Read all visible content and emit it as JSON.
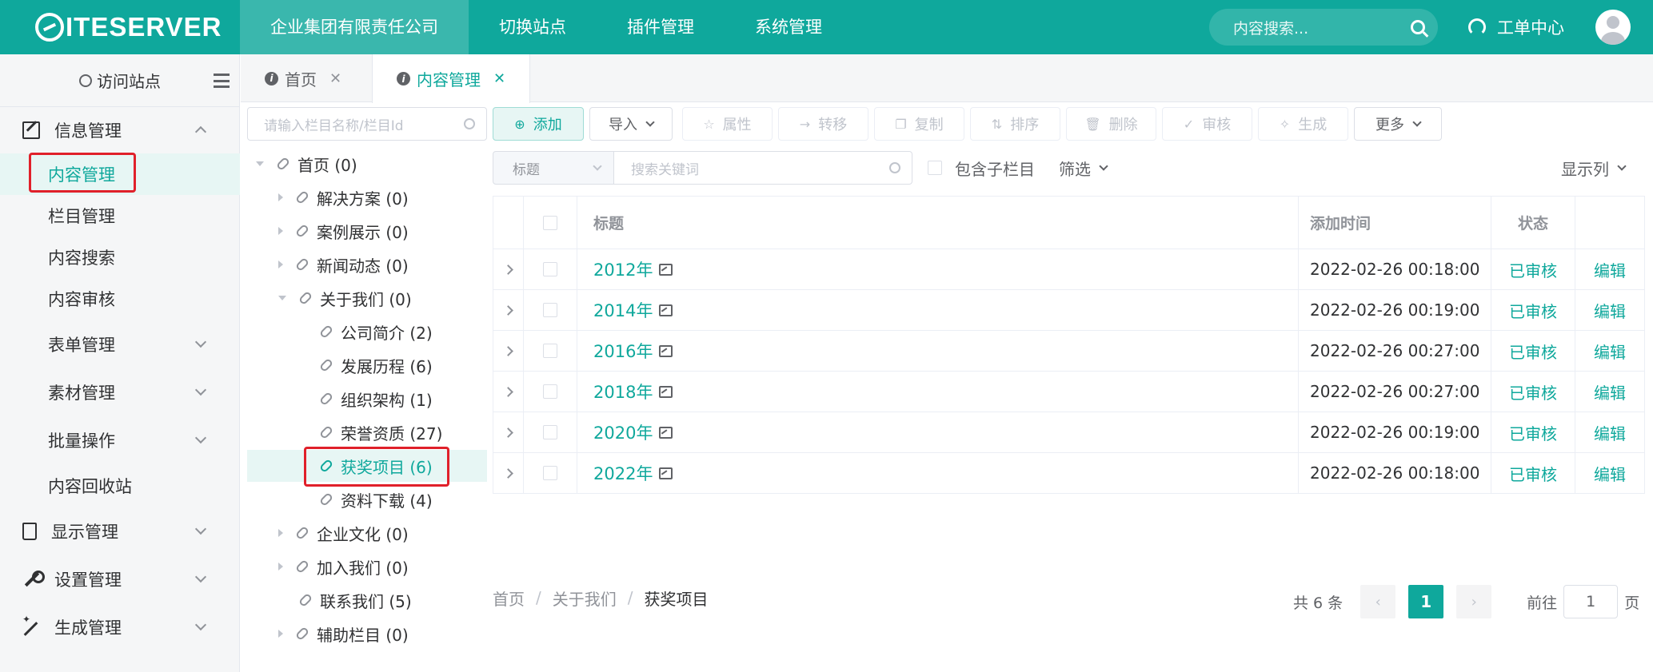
{
  "brand": {
    "logo_text": "ITESERVER"
  },
  "topnav": {
    "items": [
      "企业集团有限责任公司",
      "切换站点",
      "插件管理",
      "系统管理"
    ]
  },
  "top_search": {
    "placeholder": "内容搜索..."
  },
  "workorder": {
    "label": "工单中心"
  },
  "sidebar": {
    "visit_label": "访问站点",
    "groups": {
      "info": "信息管理",
      "display": "显示管理",
      "settings": "设置管理",
      "generate": "生成管理"
    },
    "items": {
      "content": "内容管理",
      "channel": "栏目管理",
      "search": "内容搜索",
      "review": "内容审核",
      "forms": "表单管理",
      "material": "素材管理",
      "batch": "批量操作",
      "recycle": "内容回收站"
    }
  },
  "tabs": [
    {
      "label": "首页"
    },
    {
      "label": "内容管理"
    }
  ],
  "tree": {
    "search_placeholder": "请输入栏目名称/栏目Id",
    "nodes": [
      "首页 (0)",
      "解决方案 (0)",
      "案例展示 (0)",
      "新闻动态 (0)",
      "关于我们 (0)",
      "公司简介 (2)",
      "发展历程 (6)",
      "组织架构 (1)",
      "荣誉资质 (27)",
      "获奖项目 (6)",
      "资料下载 (4)",
      "企业文化 (0)",
      "加入我们 (0)",
      "联系我们 (5)",
      "辅助栏目 (0)"
    ]
  },
  "toolbar": {
    "add": "添加",
    "import": "导入",
    "props": "属性",
    "move": "转移",
    "copy": "复制",
    "sort": "排序",
    "delete": "删除",
    "review": "审核",
    "generate": "生成",
    "more": "更多"
  },
  "filter": {
    "field_select": "标题",
    "keyword_placeholder": "搜索关键词",
    "include_children": "包含子栏目",
    "filter_label": "筛选",
    "columns_label": "显示列"
  },
  "table": {
    "headers": {
      "title": "标题",
      "time": "添加时间",
      "status": "状态"
    },
    "rows": [
      {
        "title": "2012年",
        "time": "2022-02-26 00:18:00",
        "status": "已审核",
        "action": "编辑"
      },
      {
        "title": "2014年",
        "time": "2022-02-26 00:19:00",
        "status": "已审核",
        "action": "编辑"
      },
      {
        "title": "2016年",
        "time": "2022-02-26 00:27:00",
        "status": "已审核",
        "action": "编辑"
      },
      {
        "title": "2018年",
        "time": "2022-02-26 00:27:00",
        "status": "已审核",
        "action": "编辑"
      },
      {
        "title": "2020年",
        "time": "2022-02-26 00:19:00",
        "status": "已审核",
        "action": "编辑"
      },
      {
        "title": "2022年",
        "time": "2022-02-26 00:18:00",
        "status": "已审核",
        "action": "编辑"
      }
    ]
  },
  "breadcrumb": [
    "首页",
    "关于我们",
    "获奖项目"
  ],
  "pagination": {
    "total": "共 6 条",
    "current": "1",
    "goto": "前往",
    "goto_value": "1",
    "page_suffix": "页"
  },
  "colors": {
    "accent": "#0fa89c",
    "highlight": "#e0202a"
  }
}
